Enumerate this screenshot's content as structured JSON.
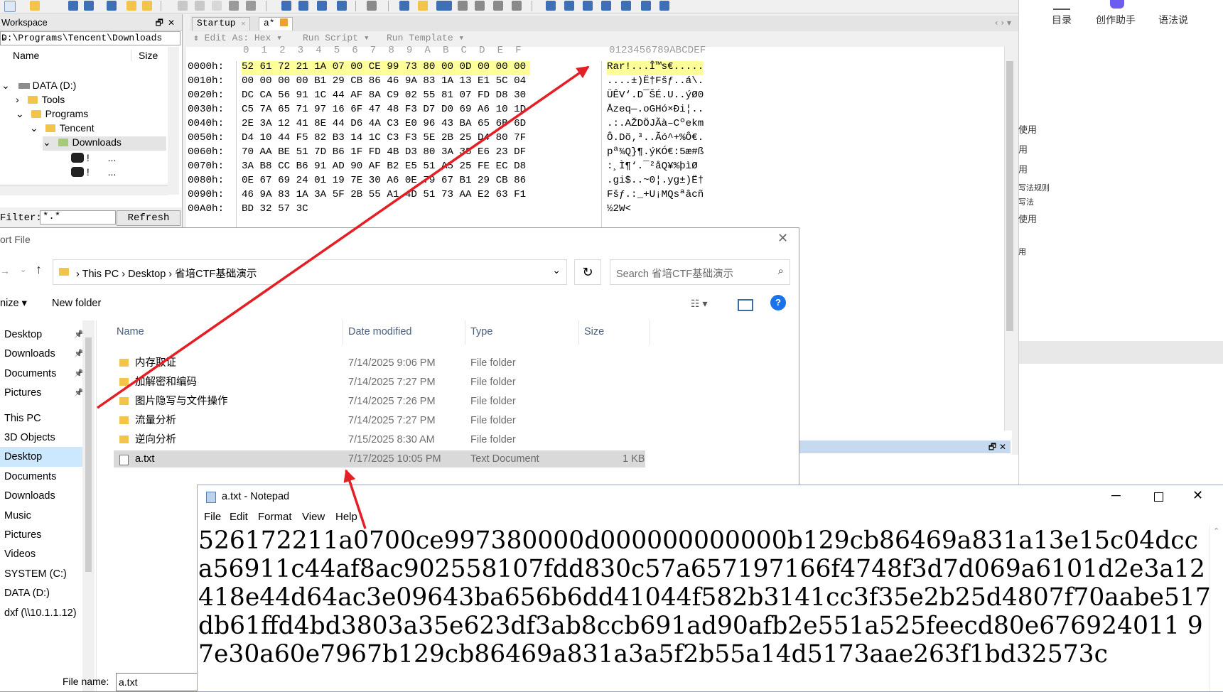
{
  "hex_editor": {
    "workspace": {
      "title": "Workspace",
      "path": "D:\\Programs\\Tencent\\Downloads",
      "col_name": "Name",
      "col_size": "Size",
      "tree": [
        "DATA (D:)",
        "Tools",
        "Programs",
        "Tencent",
        "Downloads"
      ],
      "file_stub": "...",
      "filter_label": "Filter:",
      "filter_value": "*.*",
      "refresh": "Refresh"
    },
    "tabs": [
      "Startup",
      "a*"
    ],
    "menu": [
      "Edit As: Hex",
      "Run Script",
      "Run Template"
    ],
    "column_header": "0  1  2  3  4  5  6  7  8  9  A  B  C  D  E  F",
    "ascii_header": "0123456789ABCDEF",
    "rows": [
      {
        "addr": "0000h:",
        "hex": "52 61 72 21 1A 07 00 CE 99 73 80 00 0D 00 00 00",
        "ascii": "Rar!...Î™s€....."
      },
      {
        "addr": "0010h:",
        "hex": "00 00 00 00 B1 29 CB 86 46 9A 83 1A 13 E1 5C 04",
        "ascii": "....±)Ë†Fšƒ..á\\."
      },
      {
        "addr": "0020h:",
        "hex": "DC CA 56 91 1C 44 AF 8A C9 02 55 81 07 FD D8 30",
        "ascii": "ÜÊV‘.D¯ŠÉ.U..ýØ0"
      },
      {
        "addr": "0030h:",
        "hex": "C5 7A 65 71 97 16 6F 47 48 F3 D7 D0 69 A6 10 1D",
        "ascii": "Åzeq—.oGHó×Ði¦.."
      },
      {
        "addr": "0040h:",
        "hex": "2E 3A 12 41 8E 44 D6 4A C3 E0 96 43 BA 65 6B 6D",
        "ascii": ".:.AŽDÖJÃà–Cºekm"
      },
      {
        "addr": "0050h:",
        "hex": "D4 10 44 F5 82 B3 14 1C C3 F3 5E 2B 25 D4 80 7F",
        "ascii": "Ô.Dõ‚³..Ãó^+%Ô€."
      },
      {
        "addr": "0060h:",
        "hex": "70 AA BE 51 7D B6 1F FD 4B D3 80 3A 35 E6 23 DF",
        "ascii": "pª¾Q}¶.ýKÓ€:5æ#ß"
      },
      {
        "addr": "0070h:",
        "hex": "3A B8 CC B6 91 AD 90 AF B2 E5 51 A5 25 FE EC D8",
        "ascii": ":¸Ì¶‘­.¯²åQ¥%þìØ"
      },
      {
        "addr": "0080h:",
        "hex": "0E 67 69 24 01 19 7E 30 A6 0E 79 67 B1 29 CB 86",
        "ascii": ".gi$..~0¦.yg±)Ë†"
      },
      {
        "addr": "0090h:",
        "hex": "46 9A 83 1A 3A 5F 2B 55 A1 4D 51 73 AA E2 63 F1",
        "ascii": "Fšƒ.:_+U¡MQsªâcñ"
      },
      {
        "addr": "00A0h:",
        "hex": "BD 32 57 3C",
        "ascii": "½2W<"
      }
    ]
  },
  "right_sidebar": {
    "labels": [
      "目录",
      "创作助手",
      "语法说"
    ],
    "items": [
      "使用",
      "用",
      "用",
      "写法规则",
      "写法",
      "使用",
      "用"
    ]
  },
  "file_dialog": {
    "title": "ort File",
    "breadcrumb": [
      "This PC",
      "Desktop",
      "省培CTF基础演示"
    ],
    "search_placeholder": "Search 省培CTF基础演示",
    "organize": "nize ▾",
    "new_folder": "New folder",
    "columns": [
      "Name",
      "Date modified",
      "Type",
      "Size"
    ],
    "nav_items": [
      "Desktop",
      "Downloads",
      "Documents",
      "Pictures",
      "This PC",
      "3D Objects",
      "Desktop",
      "Documents",
      "Downloads",
      "Music",
      "Pictures",
      "Videos",
      "SYSTEM (C:)",
      "DATA (D:)",
      "dxf (\\\\10.1.1.12)"
    ],
    "files": [
      {
        "name": "内存取证",
        "date": "7/14/2025 9:06 PM",
        "type": "File folder",
        "size": ""
      },
      {
        "name": "加解密和编码",
        "date": "7/14/2025 7:27 PM",
        "type": "File folder",
        "size": ""
      },
      {
        "name": "图片隐写与文件操作",
        "date": "7/14/2025 7:26 PM",
        "type": "File folder",
        "size": ""
      },
      {
        "name": "流量分析",
        "date": "7/14/2025 7:27 PM",
        "type": "File folder",
        "size": ""
      },
      {
        "name": "逆向分析",
        "date": "7/15/2025 8:30 AM",
        "type": "File folder",
        "size": ""
      },
      {
        "name": "a.txt",
        "date": "7/17/2025 10:05 PM",
        "type": "Text Document",
        "size": "1 KB"
      }
    ],
    "file_name_label": "File name:",
    "file_name_value": "a.txt"
  },
  "notepad": {
    "title": "a.txt - Notepad",
    "menu": [
      "File",
      "Edit",
      "Format",
      "View",
      "Help"
    ],
    "lines": [
      "526172211a0700ce997380000d000000000000b129cb86469a831a13e15c04dcc",
      "a56911c44af8ac902558107fdd830c57a657197166f4748f3d7d069a6101d2e3a12",
      "418e44d64ac3e09643ba656b6dd41044f582b3141cc3f35e2b25d4807f70aabe517",
      "db61ffd4bd3803a35e623df3ab8ccb691ad90afb2e551a525feecd80e676924011 9",
      "7e30a60e7967b129cb86469a831a3a5f2b55a14d5173aae263f1bd32573c"
    ]
  },
  "colors": {
    "arrow": "#e31e24",
    "hex_highlight": "#ffff99",
    "selection": "#cce8ff",
    "help": "#1a73e8"
  }
}
